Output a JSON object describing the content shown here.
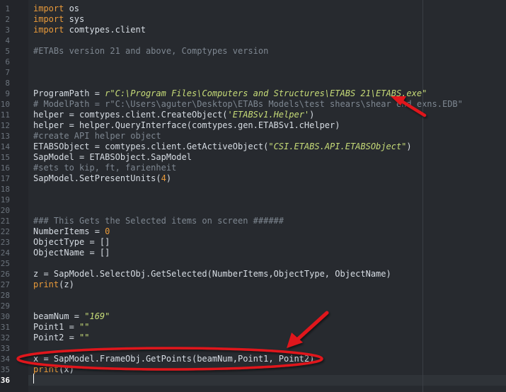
{
  "editor": {
    "current_line": 36,
    "lines": [
      {
        "n": "1",
        "tokens": [
          {
            "t": "import",
            "c": "kw"
          },
          {
            "t": " os",
            "c": "pl"
          }
        ]
      },
      {
        "n": "2",
        "tokens": [
          {
            "t": "import",
            "c": "kw"
          },
          {
            "t": " sys",
            "c": "pl"
          }
        ]
      },
      {
        "n": "3",
        "tokens": [
          {
            "t": "import",
            "c": "kw"
          },
          {
            "t": " comtypes.client",
            "c": "pl"
          }
        ]
      },
      {
        "n": "4",
        "tokens": []
      },
      {
        "n": "5",
        "tokens": [
          {
            "t": "#ETABs version 21 and above, Comptypes version",
            "c": "cmt"
          }
        ]
      },
      {
        "n": "6",
        "tokens": []
      },
      {
        "n": "7",
        "tokens": []
      },
      {
        "n": "8",
        "tokens": []
      },
      {
        "n": "9",
        "tokens": [
          {
            "t": "ProgramPath = ",
            "c": "pl"
          },
          {
            "t": "r\"C:\\Program Files\\Computers and Structures\\ETABS 21\\ETABS.exe\"",
            "c": "str"
          }
        ]
      },
      {
        "n": "10",
        "tokens": [
          {
            "t": "# ModelPath = r\"C:\\Users\\aguter\\Desktop\\ETABs Models\\test shears\\shear end exns.EDB\"",
            "c": "cmt"
          }
        ]
      },
      {
        "n": "11",
        "tokens": [
          {
            "t": "helper = comtypes.client.CreateObject(",
            "c": "pl"
          },
          {
            "t": "'ETABSv1.Helper'",
            "c": "str"
          },
          {
            "t": ")",
            "c": "pl"
          }
        ]
      },
      {
        "n": "12",
        "tokens": [
          {
            "t": "helper = helper.QueryInterface(comtypes.gen.ETABSv1.cHelper)",
            "c": "pl"
          }
        ]
      },
      {
        "n": "13",
        "tokens": [
          {
            "t": "#create API helper object",
            "c": "cmt"
          }
        ]
      },
      {
        "n": "14",
        "tokens": [
          {
            "t": "ETABSObject = comtypes.client.GetActiveObject(",
            "c": "pl"
          },
          {
            "t": "\"CSI.ETABS.API.ETABSObject\"",
            "c": "str"
          },
          {
            "t": ")",
            "c": "pl"
          }
        ]
      },
      {
        "n": "15",
        "tokens": [
          {
            "t": "SapModel = ETABSObject.SapModel",
            "c": "pl"
          }
        ]
      },
      {
        "n": "16",
        "tokens": [
          {
            "t": "#sets to kip, ft, farienheit",
            "c": "cmt"
          }
        ]
      },
      {
        "n": "17",
        "tokens": [
          {
            "t": "SapModel.SetPresentUnits(",
            "c": "pl"
          },
          {
            "t": "4",
            "c": "num"
          },
          {
            "t": ")",
            "c": "pl"
          }
        ]
      },
      {
        "n": "18",
        "tokens": []
      },
      {
        "n": "19",
        "tokens": []
      },
      {
        "n": "20",
        "tokens": []
      },
      {
        "n": "21",
        "tokens": [
          {
            "t": "### This Gets the Selected items on screen ######",
            "c": "cmt"
          }
        ]
      },
      {
        "n": "22",
        "tokens": [
          {
            "t": "NumberItems = ",
            "c": "pl"
          },
          {
            "t": "0",
            "c": "num"
          }
        ]
      },
      {
        "n": "23",
        "tokens": [
          {
            "t": "ObjectType = []",
            "c": "pl"
          }
        ]
      },
      {
        "n": "24",
        "tokens": [
          {
            "t": "ObjectName = []",
            "c": "pl"
          }
        ]
      },
      {
        "n": "25",
        "tokens": []
      },
      {
        "n": "26",
        "tokens": [
          {
            "t": "z = SapModel.SelectObj.GetSelected(NumberItems,ObjectType, ObjectName)",
            "c": "pl"
          }
        ]
      },
      {
        "n": "27",
        "tokens": [
          {
            "t": "print",
            "c": "kw"
          },
          {
            "t": "(z)",
            "c": "pl"
          }
        ]
      },
      {
        "n": "28",
        "tokens": []
      },
      {
        "n": "29",
        "tokens": []
      },
      {
        "n": "30",
        "tokens": [
          {
            "t": "beamNum = ",
            "c": "pl"
          },
          {
            "t": "\"169\"",
            "c": "str"
          }
        ]
      },
      {
        "n": "31",
        "tokens": [
          {
            "t": "Point1 = ",
            "c": "pl"
          },
          {
            "t": "\"\"",
            "c": "str"
          }
        ]
      },
      {
        "n": "32",
        "tokens": [
          {
            "t": "Point2 = ",
            "c": "pl"
          },
          {
            "t": "\"\"",
            "c": "str"
          }
        ]
      },
      {
        "n": "33",
        "tokens": []
      },
      {
        "n": "34",
        "tokens": [
          {
            "t": "x = SapModel.FrameObj.GetPoints(beamNum,Point1, Point2)",
            "c": "pl"
          }
        ]
      },
      {
        "n": "35",
        "tokens": [
          {
            "t": "print",
            "c": "kw"
          },
          {
            "t": "(x)",
            "c": "pl"
          }
        ]
      },
      {
        "n": "36",
        "tokens": []
      }
    ]
  },
  "colors": {
    "background": "#272a2f",
    "keyword": "#e99a3a",
    "string": "#c7dc78",
    "comment": "#7e8791",
    "annotation_red": "#e0191b"
  },
  "annotations": [
    {
      "type": "arrow",
      "color": "annotation_red",
      "target_line": "9"
    },
    {
      "type": "arrow",
      "color": "annotation_red",
      "target_line": "34"
    },
    {
      "type": "ellipse",
      "color": "annotation_red",
      "target_line": "34"
    }
  ]
}
